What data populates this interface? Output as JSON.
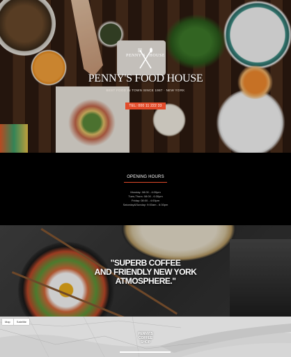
{
  "hero": {
    "logo_left": "PENNY'S",
    "logo_right": "HOUSE",
    "title": "PENNY'S FOOD HOUSE",
    "tagline": "BEST FOOD IN TOWN SINCE 1987 · NEW YORK",
    "tel": "TEL: 000 11 222 33"
  },
  "hours": {
    "title": "OPENING HOURS",
    "lines": [
      "Monday: 08:00 - 4:00pm",
      "Tues-Thurs: 08:00 - 6:30pm",
      "Friday: 08:00 - 4:00pm",
      "Saturday&Sunday: 9:00am - 6:30pm"
    ]
  },
  "quote": {
    "line1": "\"SUPERB COFFEE",
    "line2": "AND FRIENDLY NEW YORK",
    "line3": "ATMOSPHERE.\""
  },
  "map": {
    "map_label": "Map",
    "satellite_label": "Satellite",
    "pin_line1": "PENNY'S",
    "pin_line2": "COFFEE",
    "pin_line3": "SHOP"
  },
  "colors": {
    "accent": "#e14b2a"
  },
  "icons": {
    "logo": "fork-knife-icon"
  }
}
